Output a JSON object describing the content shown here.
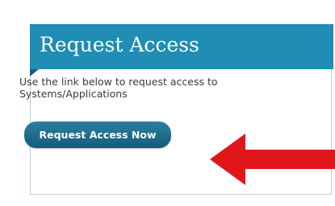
{
  "panel": {
    "title": "Request Access",
    "description": "Use the link below to request access to Systems/Applications",
    "button_label": "Request Access Now"
  },
  "colors": {
    "header": "#1f8db4",
    "button": "#1b6a8b",
    "arrow": "#e0161b"
  },
  "icons": {
    "arrow": "red-arrow-left-icon"
  }
}
